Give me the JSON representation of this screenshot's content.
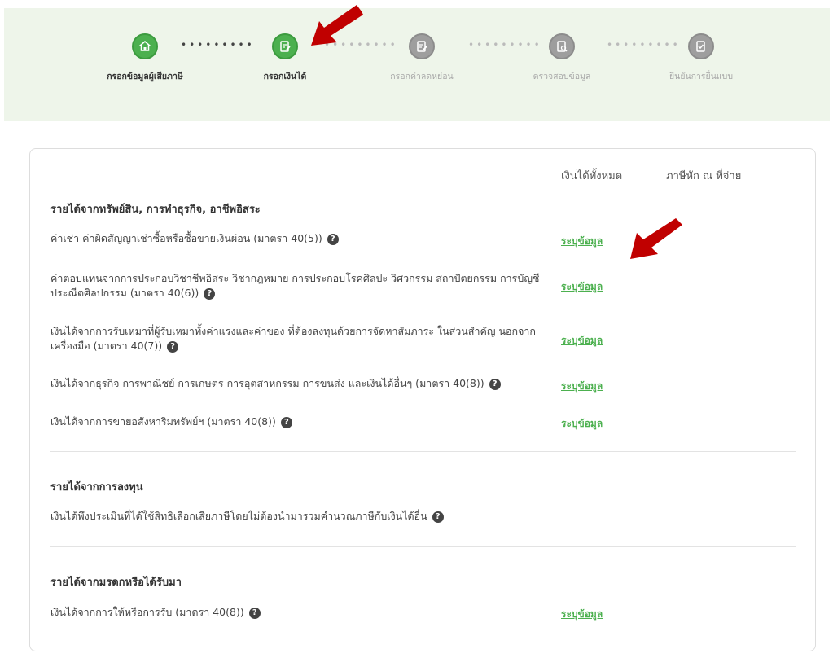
{
  "stepper": {
    "steps": [
      {
        "label": "กรอกข้อมูลผู้เสียภาษี",
        "state": "active",
        "icon": "home-icon"
      },
      {
        "label": "กรอกเงินได้",
        "state": "active",
        "icon": "edit-document-icon"
      },
      {
        "label": "กรอกค่าลดหย่อน",
        "state": "inactive",
        "icon": "edit-document-icon"
      },
      {
        "label": "ตรวจสอบข้อมูล",
        "state": "inactive",
        "icon": "review-document-icon"
      },
      {
        "label": "ยืนยันการยื่นแบบ",
        "state": "inactive",
        "icon": "confirm-document-icon"
      }
    ]
  },
  "columns": {
    "total_income": "เงินได้ทั้งหมด",
    "withholding_tax": "ภาษีหัก ณ ที่จ่าย"
  },
  "sections": {
    "business": {
      "title": "รายได้จากทรัพย์สิน, การทำธุรกิจ, อาชีพอิสระ",
      "rows": [
        {
          "text": "ค่าเช่า ค่าผิดสัญญาเช่าซื้อหรือซื้อขายเงินผ่อน (มาตรา 40(5))",
          "link": "ระบุข้อมูล"
        },
        {
          "text": "ค่าตอบแทนจากการประกอบวิชาชีพอิสระ วิชากฎหมาย การประกอบโรคศิลปะ วิศวกรรม สถาปัตยกรรม การบัญชี ประณีตศิลปกรรม (มาตรา 40(6))",
          "link": "ระบุข้อมูล"
        },
        {
          "text": "เงินได้จากการรับเหมาที่ผู้รับเหมาทั้งค่าแรงและค่าของ ที่ต้องลงทุนด้วยการจัดหาสัมภาระ ในส่วนสำคัญ นอกจากเครื่องมือ (มาตรา 40(7))",
          "link": "ระบุข้อมูล"
        },
        {
          "text": "เงินได้จากธุรกิจ การพาณิชย์ การเกษตร การอุตสาหกรรม การขนส่ง และเงินได้อื่นๆ (มาตรา 40(8))",
          "link": "ระบุข้อมูล"
        },
        {
          "text": "เงินได้จากการขายอสังหาริมทรัพย์ฯ (มาตรา 40(8))",
          "link": "ระบุข้อมูล"
        }
      ]
    },
    "investment": {
      "title": "รายได้จากการลงทุน",
      "rows": [
        {
          "text": "เงินได้พึงประเมินที่ได้ใช้สิทธิเลือกเสียภาษีโดยไม่ต้องนำมารวมคำนวณภาษีกับเงินได้อื่น"
        }
      ]
    },
    "inheritance": {
      "title": "รายได้จากมรดกหรือได้รับมา",
      "rows": [
        {
          "text": "เงินได้จากการให้หรือการรับ (มาตรา 40(8))",
          "link": "ระบุข้อมูล"
        }
      ]
    }
  },
  "colors": {
    "accent": "#4cb04f",
    "stepper_bg": "#eef5ea",
    "inactive": "#9e9e9e",
    "annotation_arrow": "#c00000"
  }
}
